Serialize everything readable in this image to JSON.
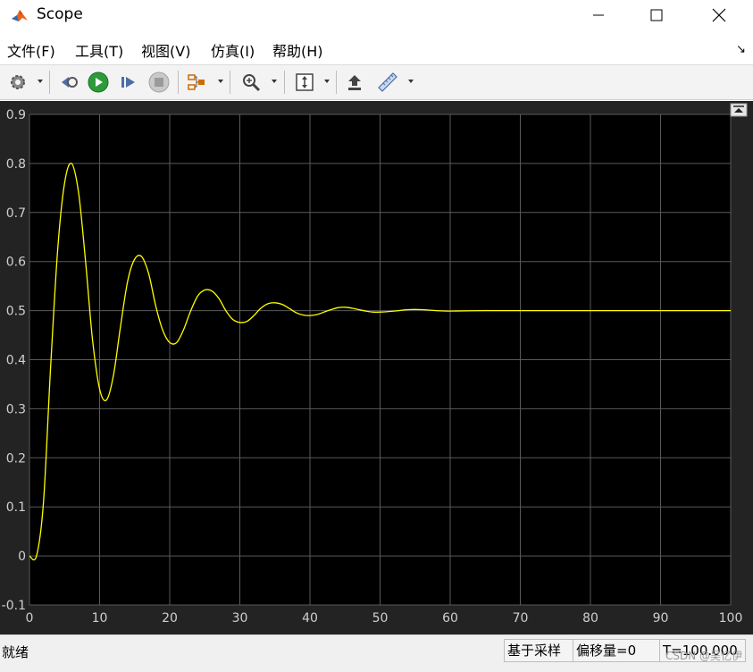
{
  "window": {
    "title": "Scope"
  },
  "menu": [
    "文件(F)",
    "工具(T)",
    "视图(V)",
    "仿真(I)",
    "帮助(H)"
  ],
  "toolbar": {
    "buttons": [
      "settings-icon",
      "step-back-icon",
      "run-icon",
      "step-forward-icon",
      "stop-icon",
      "signal-selector-icon",
      "zoom-in-icon",
      "autoscale-icon",
      "highlight-block-icon",
      "measurements-icon"
    ]
  },
  "chart_data": {
    "type": "line",
    "title": "",
    "xlabel": "",
    "ylabel": "",
    "xlim": [
      0,
      100
    ],
    "ylim": [
      -0.1,
      0.9
    ],
    "xticks": [
      "0",
      "10",
      "20",
      "30",
      "40",
      "50",
      "60",
      "70",
      "80",
      "90",
      "100"
    ],
    "yticks": [
      "-0.1",
      "0",
      "0.1",
      "0.2",
      "0.3",
      "0.4",
      "0.5",
      "0.6",
      "0.7",
      "0.8",
      "0.9"
    ],
    "grid": true,
    "colors": {
      "background": "#000000",
      "frame": "#232323",
      "grid": "#5a5a5a",
      "line": "#ffff00",
      "tick_text": "#cfcfcf"
    },
    "series": [
      {
        "x": [
          0,
          1,
          2,
          3,
          4,
          5,
          6,
          7,
          8,
          9,
          10,
          11,
          12,
          13,
          14,
          15,
          16,
          17,
          18,
          19,
          20,
          21,
          22,
          23,
          24,
          25,
          26,
          27,
          28,
          29,
          30,
          31,
          32,
          33,
          34,
          35,
          36,
          37,
          38,
          39,
          40,
          41,
          42,
          43,
          44,
          45,
          46,
          47,
          48,
          49,
          50,
          52,
          54,
          56,
          58,
          60,
          65,
          70,
          75,
          80,
          85,
          90,
          95,
          100
        ],
        "y": [
          0,
          0,
          0.11,
          0.38,
          0.62,
          0.76,
          0.8,
          0.74,
          0.6,
          0.44,
          0.34,
          0.318,
          0.37,
          0.47,
          0.56,
          0.605,
          0.61,
          0.575,
          0.51,
          0.46,
          0.435,
          0.435,
          0.462,
          0.5,
          0.53,
          0.542,
          0.54,
          0.525,
          0.5,
          0.482,
          0.476,
          0.478,
          0.49,
          0.505,
          0.514,
          0.516,
          0.513,
          0.505,
          0.496,
          0.491,
          0.49,
          0.492,
          0.497,
          0.502,
          0.506,
          0.507,
          0.505,
          0.502,
          0.499,
          0.497,
          0.497,
          0.499,
          0.502,
          0.502,
          0.5,
          0.499,
          0.5,
          0.5,
          0.5,
          0.5,
          0.5,
          0.5,
          0.5,
          0.5
        ]
      }
    ]
  },
  "status": {
    "left": "就绪",
    "cells": [
      "基于采样",
      "偏移量=0",
      "T=100.000"
    ]
  },
  "watermark": "CSDN @吴忆伊"
}
